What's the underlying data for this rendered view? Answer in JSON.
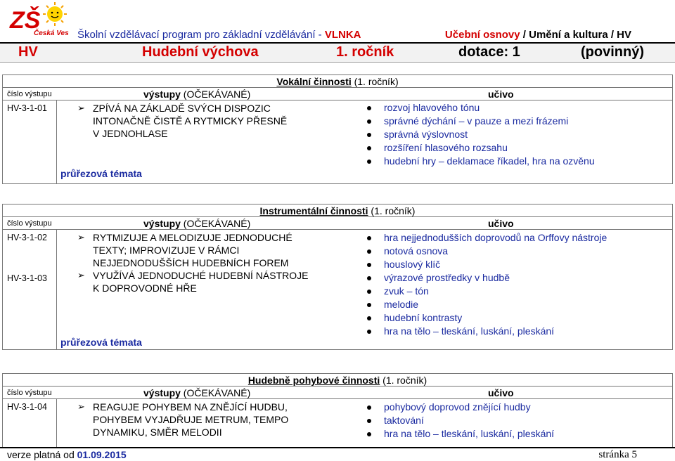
{
  "logo": {
    "text": "ZŠ",
    "subtext": "Česká Ves"
  },
  "header": {
    "program_prefix": "Školní vzdělávací program pro základní vzdělávání - ",
    "program_name": "VLNKA",
    "right_red": "Učební osnovy",
    "right_sep": " / Umění a kultura / HV"
  },
  "bar": {
    "code": "HV",
    "subject": "Hudební výchova",
    "grade": "1. ročník",
    "dotace": "dotace: 1",
    "required": "(povinný)"
  },
  "column_headers": {
    "code": "číslo výstupu",
    "outcomes_bold": "výstupy",
    "outcomes_rest": " (OČEKÁVANÉ)",
    "content": "učivo"
  },
  "sections": [
    {
      "title_bold": "Vokální činnosti",
      "title_rest": " (1. ročník)",
      "codes": [
        "HV-3-1-01"
      ],
      "outcomes": [
        "ZPÍVÁ NA ZÁKLADĚ SVÝCH DISPOZIC",
        "INTONAČNĚ ČISTĚ A RYTMICKY PŘESNĚ",
        "V JEDNOHLASE"
      ],
      "topics_label": "průřezová témata",
      "content": [
        "rozvoj hlavového tónu",
        "správné dýchání – v pauze a mezi frázemi",
        "správná výslovnost",
        "rozšíření hlasového rozsahu",
        "hudební hry – deklamace říkadel, hra na ozvěnu"
      ]
    },
    {
      "title_bold": "Instrumentální činnosti",
      "title_rest": " (1. ročník)",
      "codes": [
        "HV-3-1-02",
        "HV-3-1-03"
      ],
      "outcomes": [
        "RYTMIZUJE A MELODIZUJE JEDNODUCHÉ",
        "TEXTY; IMPROVIZUJE V RÁMCI",
        "NEJJEDNODUŠŠÍCH HUDEBNÍCH FOREM",
        "VYUŽÍVÁ JEDNODUCHÉ HUDEBNÍ NÁSTROJE",
        "K DOPROVODNÉ HŘE"
      ],
      "topics_label": "průřezová témata",
      "content": [
        "hra nejjednodušších doprovodů na Orffovy nástroje",
        "notová osnova",
        "houslový klíč",
        "výrazové prostředky v hudbě",
        "zvuk – tón",
        "melodie",
        "hudební kontrasty",
        "hra na tělo – tleskání, luskání, pleskání"
      ]
    },
    {
      "title_bold": "Hudebně pohybové činnosti",
      "title_rest": " (1. ročník)",
      "codes": [
        "HV-3-1-04"
      ],
      "outcomes": [
        "REAGUJE POHYBEM NA ZNĚJÍCÍ HUDBU,",
        "POHYBEM VYJADŘUJE METRUM, TEMPO",
        "DYNAMIKU, SMĚR MELODII"
      ],
      "content": [
        "pohybový doprovod znějící hudby",
        "taktování",
        "hra na tělo – tleskání, luskání, pleskání"
      ]
    }
  ],
  "footer": {
    "valid_from": "verze platná od ",
    "date": "01.09.2015",
    "page": "stránka 5"
  },
  "colors": {
    "red": "#d40000",
    "blue": "#1a2aa0"
  }
}
